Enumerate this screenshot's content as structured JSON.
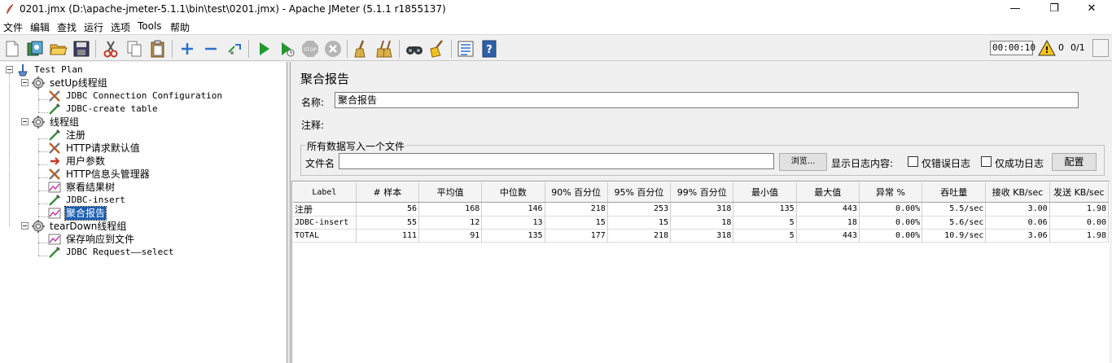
{
  "window": {
    "title": "0201.jmx (D:\\apache-jmeter-5.1.1\\bin\\test\\0201.jmx) - Apache JMeter (5.1.1 r1855137)",
    "minimize": "—",
    "maximize": "❐",
    "close": "✕"
  },
  "menu": [
    "文件",
    "编辑",
    "查找",
    "运行",
    "选项",
    "Tools",
    "帮助"
  ],
  "toolbar": {
    "icons": [
      "new-icon",
      "templates-icon",
      "open-icon",
      "save-icon",
      "cut-icon",
      "copy-icon",
      "paste-icon",
      "expand-icon",
      "collapse-icon",
      "toggle-icon",
      "start-icon",
      "start-no-pauses-icon",
      "stop-icon",
      "shutdown-icon",
      "clear-icon",
      "clear-all-icon",
      "search-icon",
      "reset-search-icon",
      "function-helper-icon",
      "help-icon"
    ],
    "timer": "00:00:10",
    "error_count": "0",
    "thread_ratio": "0/1"
  },
  "tree": {
    "nodes": [
      {
        "label": "Test Plan",
        "icon": "test-plan-icon"
      },
      {
        "label": "setUp线程组",
        "icon": "thread-group-icon"
      },
      {
        "label": "JDBC Connection Configuration",
        "icon": "config-icon"
      },
      {
        "label": "JDBC-create table",
        "icon": "sampler-icon"
      },
      {
        "label": "线程组",
        "icon": "thread-group-icon"
      },
      {
        "label": "注册",
        "icon": "sampler-icon"
      },
      {
        "label": "HTTP请求默认值",
        "icon": "config-icon"
      },
      {
        "label": "用户参数",
        "icon": "preprocessor-icon"
      },
      {
        "label": "HTTP信息头管理器",
        "icon": "config-icon"
      },
      {
        "label": "察看结果树",
        "icon": "listener-icon"
      },
      {
        "label": "JDBC-insert",
        "icon": "sampler-icon"
      },
      {
        "label": "聚合报告",
        "icon": "listener-icon"
      },
      {
        "label": "tearDown线程组",
        "icon": "thread-group-icon"
      },
      {
        "label": "保存响应到文件",
        "icon": "listener-icon"
      },
      {
        "label": "JDBC Request——select",
        "icon": "sampler-icon"
      }
    ]
  },
  "panel": {
    "title": "聚合报告",
    "name_label": "名称:",
    "name_value": "聚合报告",
    "comment_label": "注释:",
    "comment_value": "",
    "group_title": "所有数据写入一个文件",
    "filename_label": "文件名",
    "filename_value": "",
    "browse_button": "浏览...",
    "log_content_label": "显示日志内容:",
    "errors_only_label": "仅错误日志",
    "success_only_label": "仅成功日志",
    "configure_button": "配置"
  },
  "table": {
    "columns": [
      "Label",
      "# 样本",
      "平均值",
      "中位数",
      "90% 百分位",
      "95% 百分位",
      "99% 百分位",
      "最小值",
      "最大值",
      "异常 %",
      "吞吐量",
      "接收 KB/sec",
      "发送 KB/sec"
    ],
    "rows": [
      [
        "注册",
        "56",
        "168",
        "146",
        "218",
        "253",
        "318",
        "135",
        "443",
        "0.00%",
        "5.5/sec",
        "3.00",
        "1.98"
      ],
      [
        "JDBC-insert",
        "55",
        "12",
        "13",
        "15",
        "15",
        "18",
        "5",
        "18",
        "0.00%",
        "5.6/sec",
        "0.06",
        "0.00"
      ],
      [
        "TOTAL",
        "111",
        "91",
        "135",
        "177",
        "218",
        "318",
        "5",
        "443",
        "0.00%",
        "10.9/sec",
        "3.06",
        "1.98"
      ]
    ]
  }
}
